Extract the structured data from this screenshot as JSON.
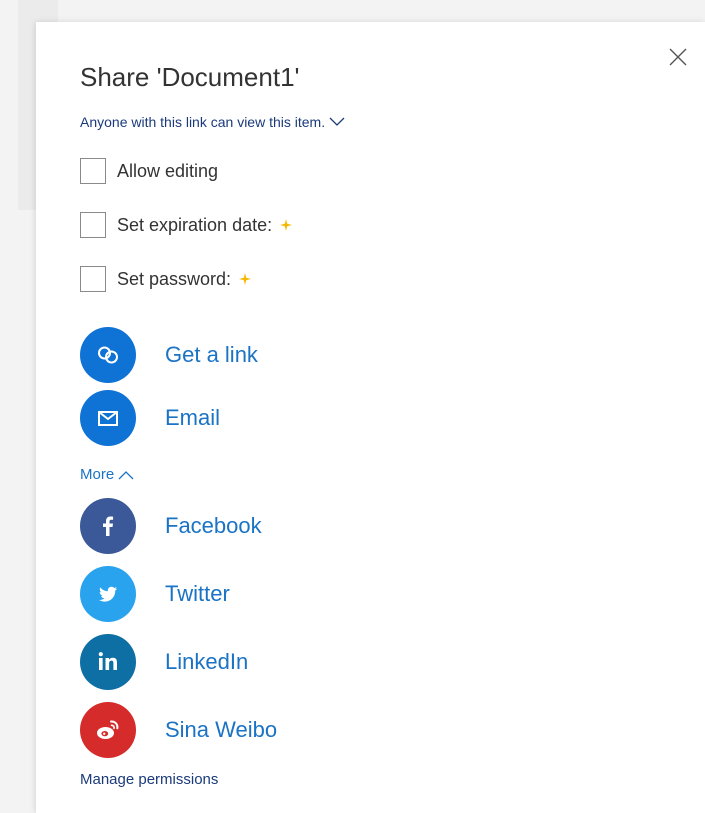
{
  "dialog": {
    "title": "Share 'Document1'",
    "permission_text": "Anyone with this link can view this item.",
    "close_icon": "close-icon"
  },
  "options": [
    {
      "label": "Allow editing",
      "checked": false,
      "premium": false
    },
    {
      "label": "Set expiration date:",
      "checked": false,
      "premium": true
    },
    {
      "label": "Set password:",
      "checked": false,
      "premium": true
    }
  ],
  "share_methods": [
    {
      "label": "Get a link",
      "icon": "link-icon",
      "color": "#0f72d5"
    },
    {
      "label": "Email",
      "icon": "mail-icon",
      "color": "#0f72d5"
    }
  ],
  "more": {
    "label": "More",
    "icon": "chevron-up-icon"
  },
  "social": [
    {
      "label": "Facebook",
      "icon": "facebook-icon",
      "color": "#3b5998"
    },
    {
      "label": "Twitter",
      "icon": "twitter-icon",
      "color": "#2aa3ef"
    },
    {
      "label": "LinkedIn",
      "icon": "linkedin-icon",
      "color": "#0e6fa5"
    },
    {
      "label": "Sina Weibo",
      "icon": "weibo-icon",
      "color": "#d52b2b"
    }
  ],
  "manage_permissions_label": "Manage permissions",
  "colors": {
    "accent": "#1a73c4",
    "premium_star": "#f5b800",
    "dark_link": "#1b3a7a"
  }
}
